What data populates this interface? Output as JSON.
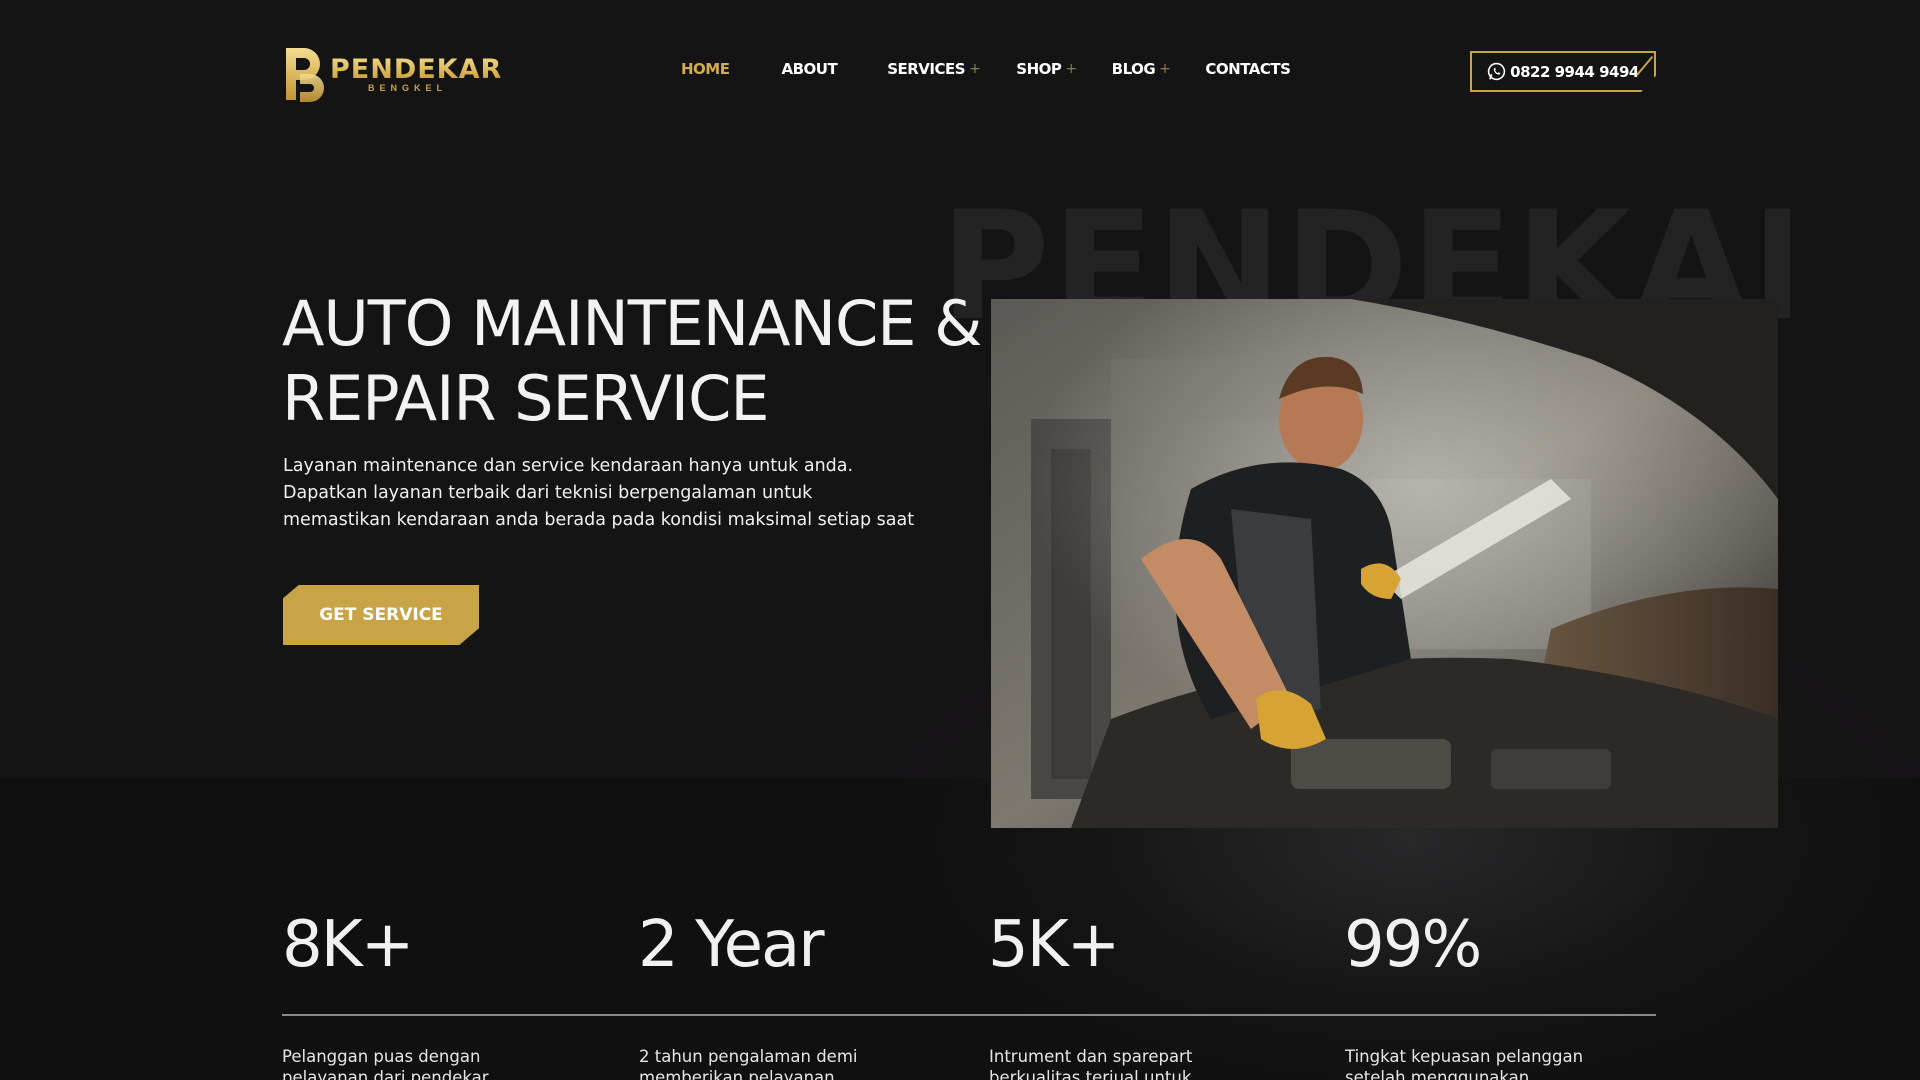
{
  "colors": {
    "background": "#151415",
    "accent": "#c9a447",
    "active_nav": "#d2ad4e",
    "text": "#ffffff"
  },
  "brand": {
    "name": "PENDEKAR",
    "sub": "BENGKEL"
  },
  "nav": {
    "items": [
      {
        "label": "HOME",
        "active": true,
        "has_submenu": false
      },
      {
        "label": "ABOUT",
        "active": false,
        "has_submenu": false
      },
      {
        "label": "SERVICES",
        "active": false,
        "has_submenu": true
      },
      {
        "label": "SHOP",
        "active": false,
        "has_submenu": true
      },
      {
        "label": "BLOG",
        "active": false,
        "has_submenu": true
      },
      {
        "label": "CONTACTS",
        "active": false,
        "has_submenu": false
      }
    ],
    "submenu_marker": "+"
  },
  "contact": {
    "phone": "0822 9944 9494",
    "icon": "whatsapp-icon"
  },
  "hero": {
    "watermark": "PENDEKAR",
    "title_line1": "AUTO MAINTENANCE &",
    "title_line2": "REPAIR SERVICE",
    "desc_line1": "Layanan maintenance dan service kendaraan hanya untuk anda.",
    "desc_line2": "Dapatkan layanan terbaik dari teknisi berpengalaman untuk",
    "desc_line3": "memastikan kendaraan anda berada pada kondisi maksimal setiap saat",
    "cta_label": "GET SERVICE"
  },
  "stats": [
    {
      "value": "8K+",
      "desc_line1": "Pelanggan puas dengan",
      "desc_line2": "pelayanan dari pendekar"
    },
    {
      "value": "2 Year",
      "desc_line1": "2 tahun pengalaman demi",
      "desc_line2": "memberikan pelayanan terbaik"
    },
    {
      "value": "5K+",
      "desc_line1": "Intrument dan sparepart",
      "desc_line2": "berkualitas terjual untuk"
    },
    {
      "value": "99%",
      "desc_line1": "Tingkat kepuasan pelanggan",
      "desc_line2": "setelah menggunakan layanan"
    }
  ]
}
